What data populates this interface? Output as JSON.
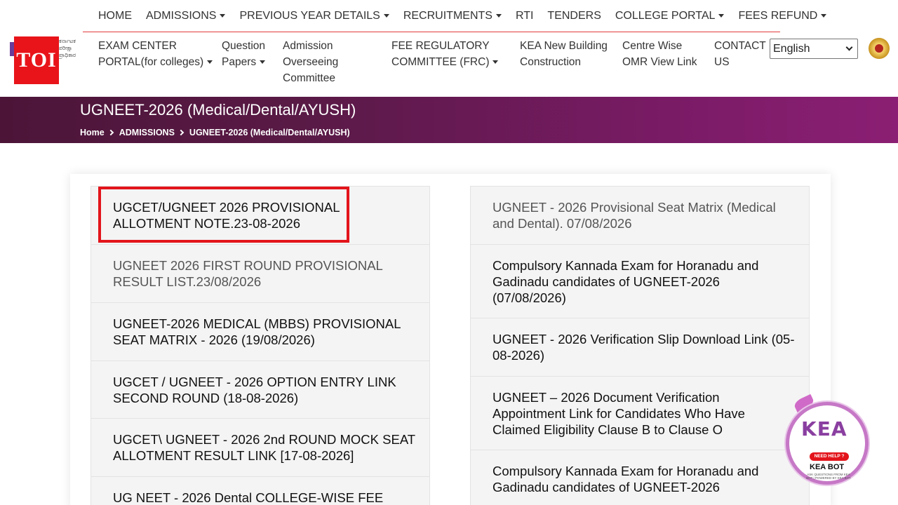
{
  "top_nav": [
    {
      "label": "HOME",
      "dropdown": false
    },
    {
      "label": "ADMISSIONS",
      "dropdown": true
    },
    {
      "label": "PREVIOUS YEAR DETAILS",
      "dropdown": true
    },
    {
      "label": "RECRUITMENTS",
      "dropdown": true
    },
    {
      "label": "RTI",
      "dropdown": false
    },
    {
      "label": "TENDERS",
      "dropdown": false
    },
    {
      "label": "COLLEGE PORTAL",
      "dropdown": true
    },
    {
      "label": "FEES REFUND",
      "dropdown": true
    }
  ],
  "logo": {
    "text": "TOI",
    "kannada_text": "ಕರ್ನಾಟಕ ಪರೀಕ್ಷಾ ಪ್ರಾಧಿಕಾರ",
    "color": "#e8141a"
  },
  "second_nav": {
    "exam_center": {
      "line1": "EXAM CENTER",
      "line2": "PORTAL(for colleges)"
    },
    "question_papers": {
      "line1": "Question",
      "line2": "Papers"
    },
    "admission_committee": {
      "line1": "Admission",
      "line2": "Overseeing",
      "line3": "Committee"
    },
    "fee_regulatory": {
      "line1": "FEE REGULATORY",
      "line2": "COMMITTEE (FRC)"
    },
    "kea_building": {
      "line1": "KEA New Building",
      "line2": "Construction"
    },
    "omr_link": {
      "line1": "Centre Wise",
      "line2": "OMR View Link"
    },
    "contact": {
      "line1": "CONTACT",
      "line2": "US"
    }
  },
  "language_select": {
    "value": "English"
  },
  "banner": {
    "title": "UGNEET-2026 (Medical/Dental/AYUSH)",
    "breadcrumb": [
      "Home",
      "ADMISSIONS",
      "UGNEET-2026 (Medical/Dental/AYUSH)"
    ],
    "colors": {
      "start": "#4c1538",
      "end": "#8b1f73"
    }
  },
  "left_column": [
    {
      "text": "UGCET/UGNEET 2026 PROVISIONAL ALLOTMENT NOTE.23-08-2026",
      "highlighted": true
    },
    {
      "text": "UGNEET 2026 FIRST ROUND PROVISIONAL RESULT LIST.23/08/2026",
      "muted": true
    },
    {
      "text": "UGNEET-2026 MEDICAL (MBBS) PROVISIONAL SEAT MATRIX - 2026 (19/08/2026)"
    },
    {
      "text": "UGCET / UGNEET - 2026 OPTION ENTRY LINK SECOND ROUND (18-08-2026)"
    },
    {
      "text": "UGCET\\ UGNEET - 2026 2nd ROUND MOCK SEAT ALLOTMENT RESULT LINK [17-08-2026]"
    },
    {
      "text": "UG NEET - 2026 Dental COLLEGE-WISE FEE"
    }
  ],
  "right_column": [
    {
      "text": "UGNEET - 2026 Provisional Seat Matrix (Medical and Dental). 07/08/2026",
      "muted": true
    },
    {
      "text": "Compulsory Kannada Exam for Horanadu and Gadinadu candidates of UGNEET-2026 (07/08/2026)"
    },
    {
      "text": "UGNEET - 2026 Verification Slip Download Link (05-08-2026)"
    },
    {
      "text": "UGNEET – 2026 Document Verification Appointment Link for Candidates Who Have Claimed Eligibility Clause B to Clause O"
    },
    {
      "text": "Compulsory Kannada Exam for Horanadu and Gadinadu candidates of UGNEET-2026"
    }
  ],
  "kea_bot": {
    "logo_text": "KEA",
    "help_label": "NEED HELP ?",
    "name": "KEA BOT",
    "subtext": "ASK QUESTIONS FROM KEA BOT | POWERED BY KEA BOT"
  },
  "accent_colors": {
    "highlight": "#e3141b",
    "nav_divider": "#e23b3b"
  }
}
